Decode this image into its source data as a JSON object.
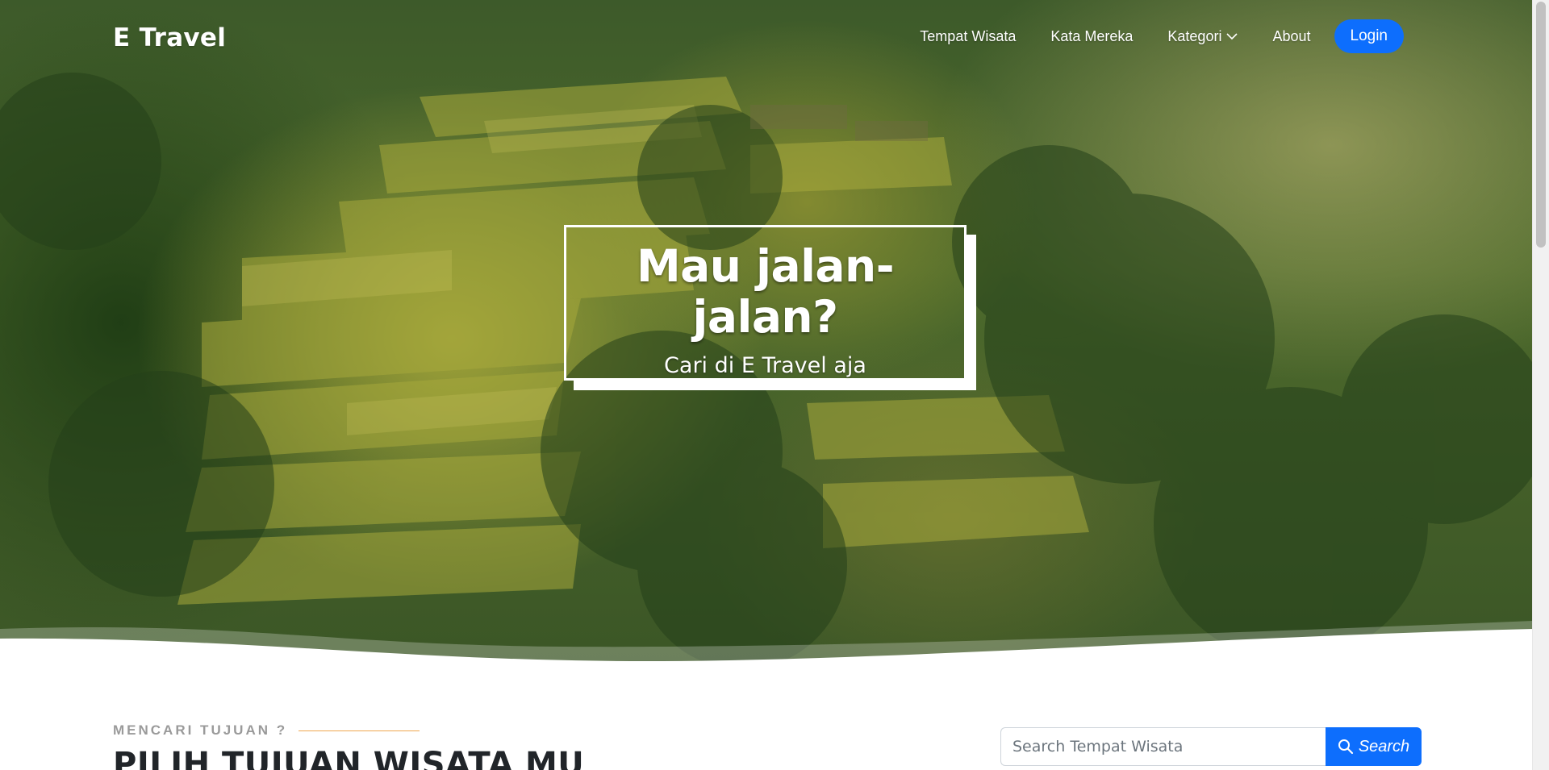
{
  "navbar": {
    "brand": "E Travel",
    "items": [
      {
        "label": "Tempat Wisata"
      },
      {
        "label": "Kata Mereka"
      },
      {
        "label": "Kategori",
        "icon": "chevron-down-icon"
      },
      {
        "label": "About"
      }
    ],
    "login_label": "Login"
  },
  "hero": {
    "title": "Mau jalan-jalan?",
    "subtitle": "Cari di E Travel aja"
  },
  "section": {
    "eyebrow": "MENCARI TUJUAN ?",
    "title": "PILIH TUJUAN WISATA MU"
  },
  "search": {
    "placeholder": "Search Tempat Wisata",
    "value": "",
    "button_label": "Search",
    "icon": "search-icon"
  },
  "colors": {
    "primary": "#0d6efd",
    "accent_line": "#f0a74e",
    "heading": "#212529"
  }
}
